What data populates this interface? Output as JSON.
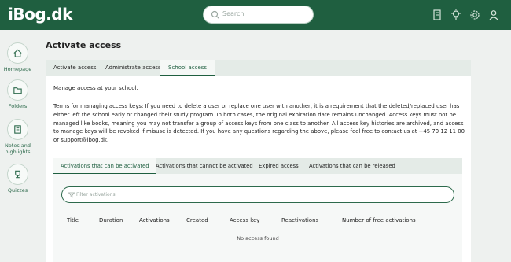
{
  "header": {
    "logo": "iBog.dk",
    "search_placeholder": "Search",
    "icons": [
      "book-icon",
      "lightbulb-icon",
      "gear-icon",
      "user-icon"
    ]
  },
  "sidebar": {
    "items": [
      {
        "label": "Homepage",
        "icon": "home-icon"
      },
      {
        "label": "Folders",
        "icon": "folder-icon"
      },
      {
        "label": "Notes and highlights",
        "icon": "notes-icon"
      },
      {
        "label": "Quizzes",
        "icon": "trophy-icon"
      }
    ]
  },
  "page": {
    "title": "Activate access",
    "tabs": [
      {
        "label": "Activate access"
      },
      {
        "label": "Administrate access"
      },
      {
        "label": "School access",
        "active": true
      }
    ],
    "description": "Manage access at your school.",
    "terms": "Terms for managing access keys: If you need to delete a user or replace one user with another, it is a requirement that the deleted/replaced user has either left the school early or changed their study program. In both cases, the original expiration date remains unchanged. Access keys must not be managed like books, meaning you may not transfer a group of access keys from one class to another. All access key histories are archived, and access to manage keys will be revoked if misuse is detected. If you have any questions regarding the above, please feel free to contact us at +45 70 12 11 00 or support@ibog.dk."
  },
  "subtabs": [
    {
      "label": "Activations that can be activated",
      "active": true
    },
    {
      "label": "Activations that cannot be activated"
    },
    {
      "label": "Expired access"
    },
    {
      "label": "Activations that can be released"
    }
  ],
  "filter": {
    "placeholder": "Filter activations"
  },
  "table": {
    "columns": [
      "Title",
      "Duration",
      "Activations",
      "Created",
      "Access key",
      "Reactivations",
      "Number of free activations"
    ],
    "empty_text": "No access found"
  },
  "colors": {
    "brand": "#1f5f40",
    "accent": "#2d6a4c"
  }
}
